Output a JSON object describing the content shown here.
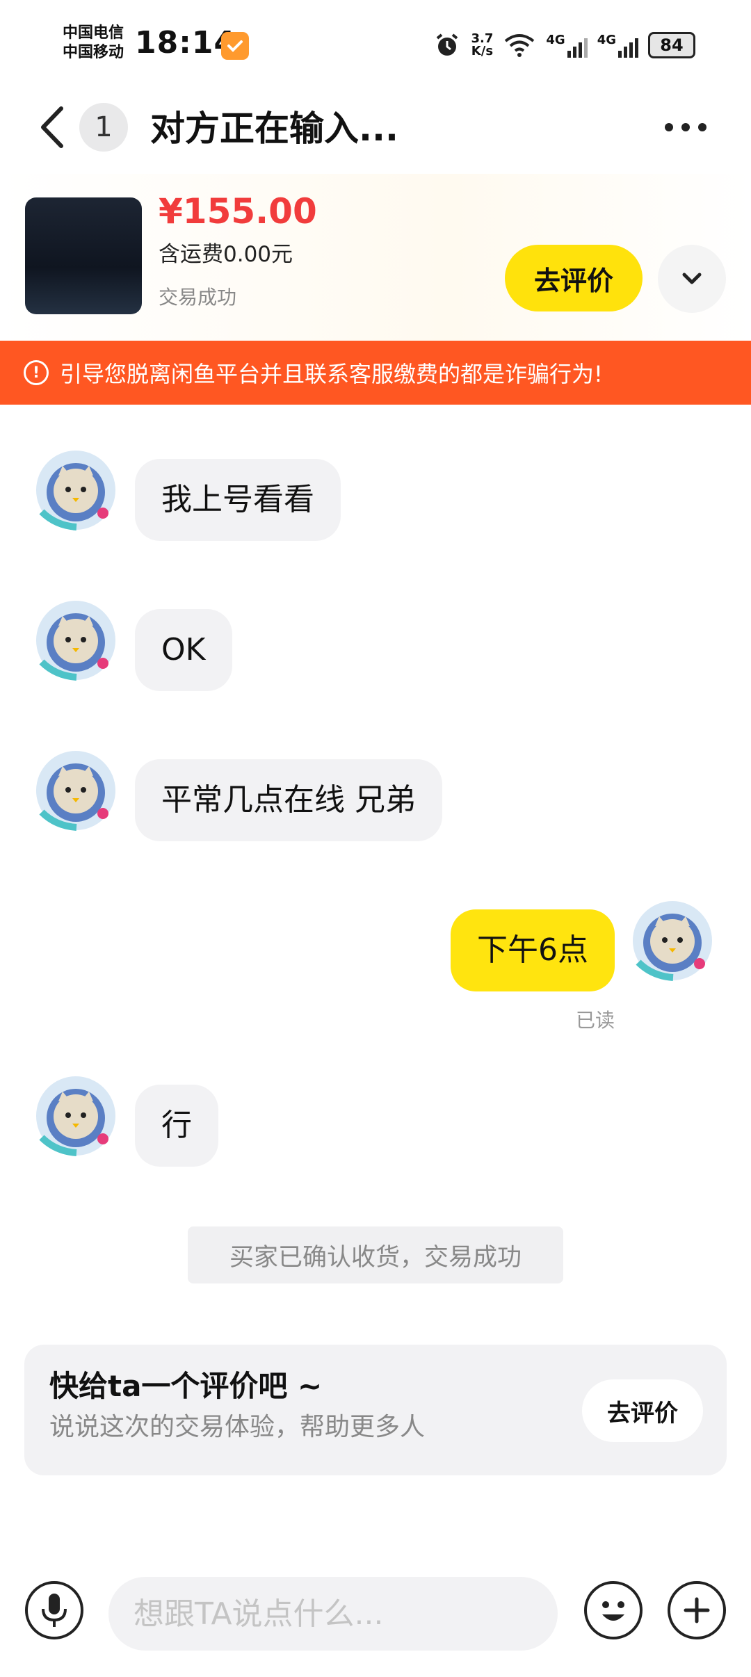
{
  "status_bar": {
    "carrier_1": "中国电信",
    "carrier_2": "中国移动",
    "time": "18:14",
    "net_speed_value": "3.7",
    "net_speed_unit": "K/s",
    "signal_1": "4G",
    "signal_2": "4G",
    "battery": "84"
  },
  "header": {
    "unread_count": "1",
    "title": "对方正在输入..."
  },
  "product": {
    "price": "¥155.00",
    "shipping": "含运费0.00元",
    "status": "交易成功",
    "rate_button": "去评价"
  },
  "warning": {
    "text": "引导您脱离闲鱼平台并且联系客服缴费的都是诈骗行为!"
  },
  "messages": [
    {
      "side": "them",
      "text": "我上号看看"
    },
    {
      "side": "them",
      "text": "OK"
    },
    {
      "side": "them",
      "text": "平常几点在线 兄弟"
    },
    {
      "side": "me",
      "text": "下午6点",
      "read_label": "已读"
    },
    {
      "side": "them",
      "text": "行"
    }
  ],
  "system_notice": "买家已确认收货，交易成功",
  "review_card": {
    "title": "快给ta一个评价吧 ~",
    "subtitle": "说说这次的交易体验，帮助更多人",
    "button": "去评价"
  },
  "input_bar": {
    "placeholder": "想跟TA说点什么..."
  },
  "colors": {
    "accent_yellow": "#ffe20c",
    "warning_orange": "#ff5722",
    "price_red": "#f13c3c",
    "bubble_gray": "#f2f2f4"
  }
}
